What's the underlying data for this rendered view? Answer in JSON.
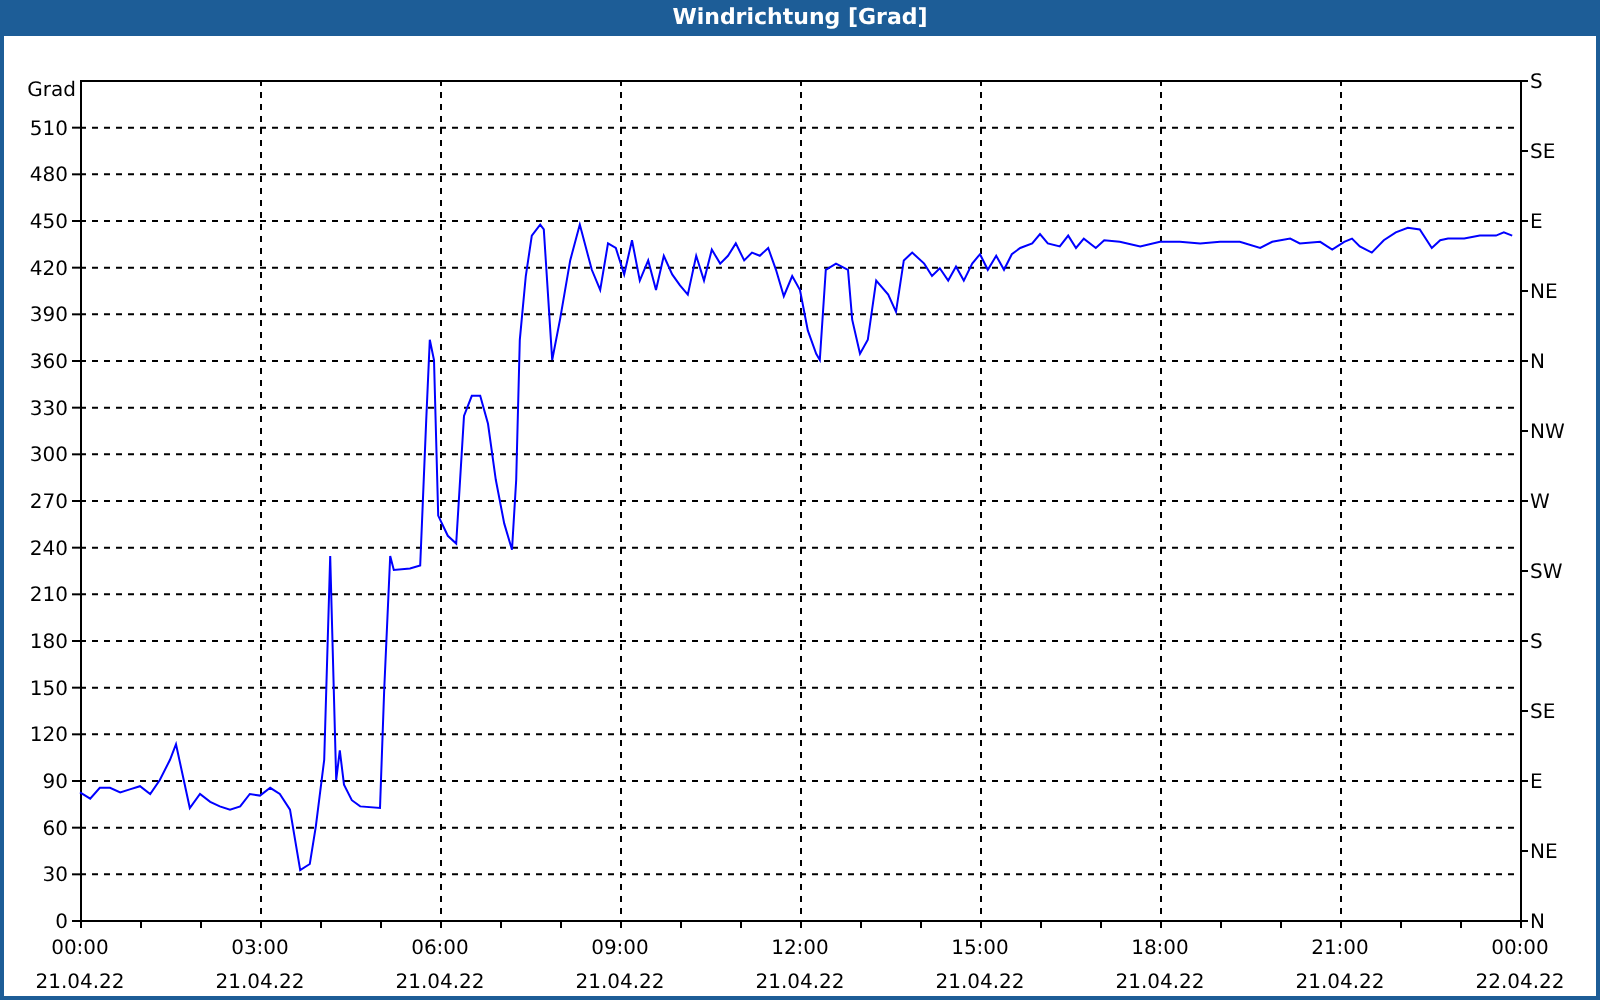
{
  "window": {
    "title": "Windrichtung [Grad]"
  },
  "chart": {
    "chart_data": {
      "type": "line",
      "ylabel": "Grad",
      "xlim": [
        0,
        24
      ],
      "ylim": [
        0,
        540
      ],
      "yticks": [
        0,
        30,
        60,
        90,
        120,
        150,
        180,
        210,
        240,
        270,
        300,
        330,
        360,
        390,
        420,
        450,
        480,
        510
      ],
      "xticks": [
        {
          "value": 0,
          "label": "00:00"
        },
        {
          "value": 3,
          "label": "03:00"
        },
        {
          "value": 6,
          "label": "06:00"
        },
        {
          "value": 9,
          "label": "09:00"
        },
        {
          "value": 12,
          "label": "12:00"
        },
        {
          "value": 15,
          "label": "15:00"
        },
        {
          "value": 18,
          "label": "18:00"
        },
        {
          "value": 21,
          "label": "21:00"
        },
        {
          "value": 24,
          "label": "00:00"
        }
      ],
      "x": [
        0,
        0.17,
        0.33,
        0.5,
        0.67,
        0.83,
        1,
        1.17,
        1.33,
        1.5,
        1.6,
        1.83,
        2,
        2.17,
        2.33,
        2.5,
        2.67,
        2.83,
        3,
        3.17,
        3.33,
        3.5,
        3.67,
        3.83,
        3.93,
        4.07,
        4.17,
        4.27,
        4.33,
        4.4,
        4.53,
        4.67,
        5,
        5.07,
        5.17,
        5.23,
        5.5,
        5.67,
        5.77,
        5.83,
        5.9,
        5.97,
        6.13,
        6.27,
        6.4,
        6.53,
        6.67,
        6.8,
        6.93,
        7.07,
        7.2,
        7.27,
        7.33,
        7.43,
        7.53,
        7.67,
        7.73,
        7.87,
        8,
        8.17,
        8.33,
        8.53,
        8.67,
        8.8,
        8.93,
        9.07,
        9.2,
        9.33,
        9.47,
        9.6,
        9.73,
        9.87,
        10,
        10.13,
        10.27,
        10.4,
        10.53,
        10.67,
        10.8,
        10.93,
        11.07,
        11.2,
        11.33,
        11.47,
        11.6,
        11.73,
        11.87,
        12,
        12.13,
        12.27,
        12.33,
        12.43,
        12.6,
        12.8,
        12.87,
        13,
        13.13,
        13.27,
        13.47,
        13.6,
        13.73,
        13.87,
        14.07,
        14.2,
        14.33,
        14.47,
        14.6,
        14.73,
        14.87,
        15,
        15.13,
        15.27,
        15.4,
        15.53,
        15.67,
        15.87,
        16,
        16.13,
        16.33,
        16.47,
        16.6,
        16.73,
        16.93,
        17.07,
        17.33,
        17.67,
        18,
        18.33,
        18.67,
        19,
        19.33,
        19.67,
        19.87,
        20.17,
        20.33,
        20.67,
        20.87,
        21.07,
        21.2,
        21.33,
        21.53,
        21.73,
        21.93,
        22.13,
        22.33,
        22.53,
        22.67,
        22.8,
        23.07,
        23.33,
        23.6,
        23.73,
        23.87
      ],
      "grid": true,
      "series": [
        {
          "color": "#0000ff",
          "values": [
            82,
            78,
            85,
            85,
            82,
            84,
            86,
            81,
            90,
            103,
            113,
            72,
            81,
            76,
            73,
            71,
            73,
            81,
            80,
            85,
            81,
            71,
            32,
            36,
            60,
            103,
            234,
            90,
            109,
            87,
            77,
            73,
            72,
            148,
            234,
            225,
            226,
            228,
            321,
            373,
            360,
            260,
            247,
            242,
            324,
            337,
            337,
            319,
            283,
            255,
            238,
            283,
            373,
            414,
            440,
            447,
            444,
            360,
            386,
            424,
            447,
            418,
            405,
            435,
            432,
            415,
            437,
            411,
            424,
            405,
            427,
            415,
            408,
            402,
            427,
            411,
            431,
            422,
            427,
            435,
            424,
            429,
            427,
            432,
            418,
            401,
            414,
            405,
            379,
            364,
            360,
            418,
            422,
            418,
            386,
            364,
            373,
            411,
            402,
            391,
            424,
            429,
            422,
            414,
            419,
            411,
            420,
            411,
            422,
            428,
            418,
            427,
            418,
            428,
            432,
            435,
            441,
            435,
            433,
            440,
            432,
            438,
            432,
            437,
            436,
            433,
            436,
            436,
            435,
            436,
            436,
            432,
            436,
            438,
            435,
            436,
            431,
            436,
            438,
            433,
            429,
            437,
            442,
            445,
            444,
            432,
            437,
            438,
            438,
            440,
            440,
            442,
            440
          ]
        }
      ]
    },
    "x_dates": [
      "21.04.22",
      "21.04.22",
      "21.04.22",
      "21.04.22",
      "21.04.22",
      "21.04.22",
      "21.04.22",
      "21.04.22",
      "22.04.22"
    ],
    "compass_axis": [
      "S",
      "SE",
      "E",
      "NE",
      "N",
      "NW",
      "W",
      "SW",
      "S",
      "SE",
      "E",
      "NE",
      "N"
    ]
  }
}
